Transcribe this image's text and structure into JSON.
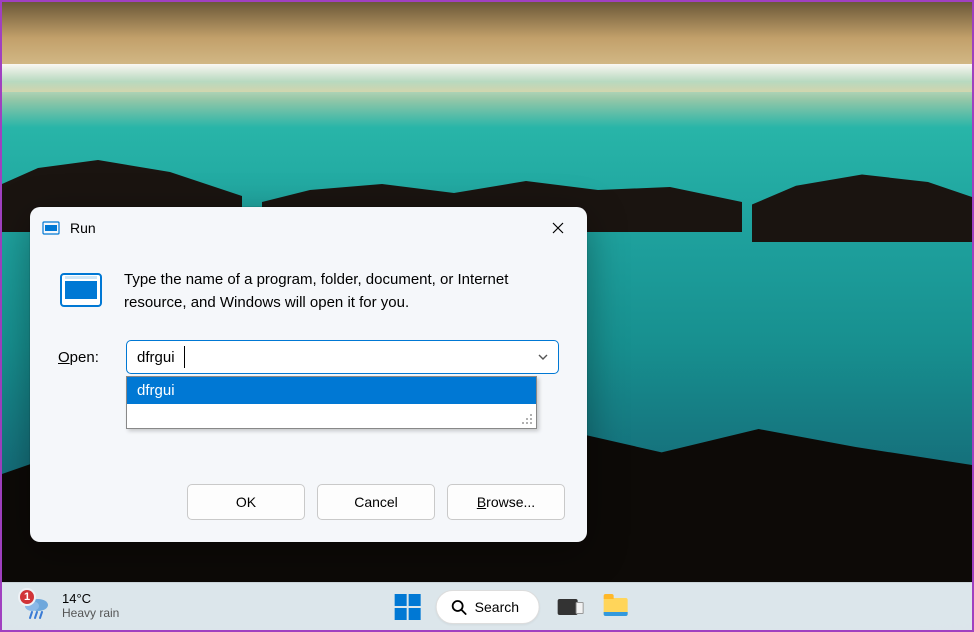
{
  "run_dialog": {
    "title": "Run",
    "description": "Type the name of a program, folder, document, or Internet resource, and Windows will open it for you.",
    "open_label_prefix": "O",
    "open_label_rest": "pen:",
    "input_value": "dfrgui",
    "autocomplete_item": "dfrgui",
    "ok_label": "OK",
    "cancel_label": "Cancel",
    "browse_prefix": "B",
    "browse_rest": "rowse..."
  },
  "taskbar": {
    "weather_badge": "1",
    "weather_temp": "14°C",
    "weather_cond": "Heavy rain",
    "search_label": "Search"
  }
}
